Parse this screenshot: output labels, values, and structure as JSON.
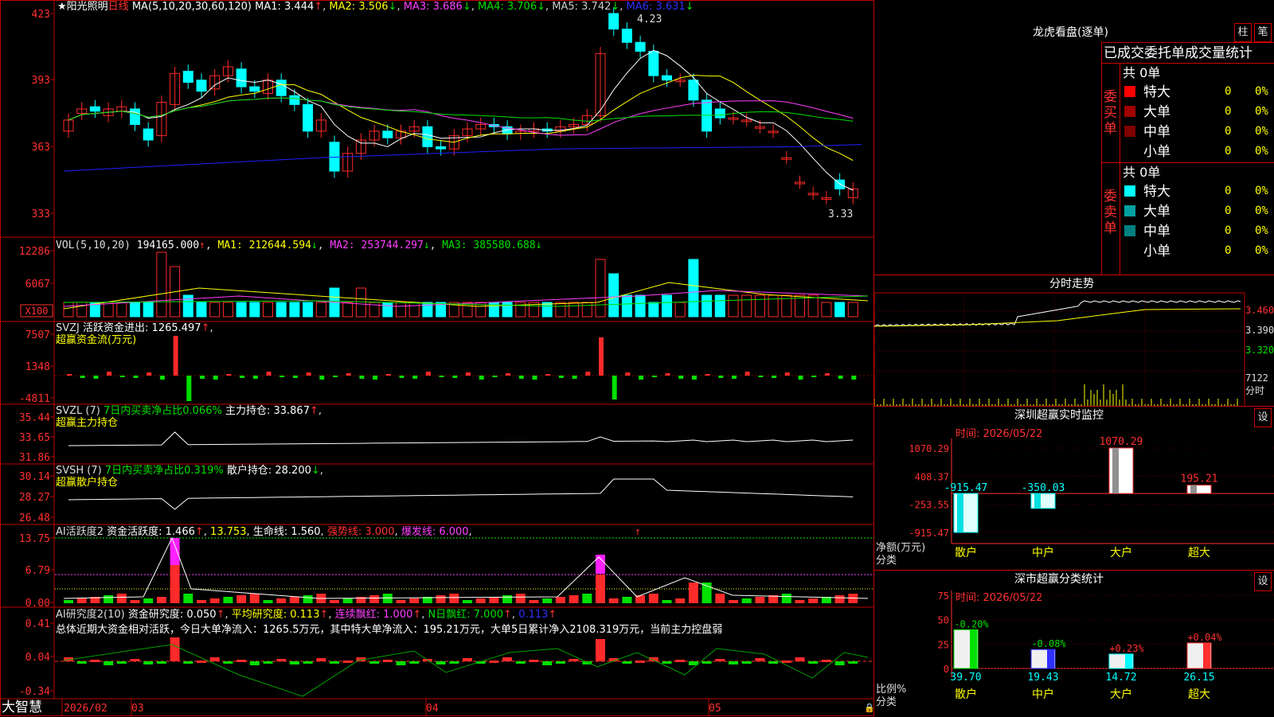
{
  "colors": {
    "up": "#ff2a2a",
    "down": "#00ffff",
    "grid": "#c00000",
    "white": "#ffffff",
    "yellow": "#ffff00",
    "magenta": "#ff40ff",
    "green": "#00e000",
    "blue": "#2020ff",
    "gray": "#a0a0a0"
  },
  "kline": {
    "stock_name": "阳光照明",
    "period": "日线",
    "ma_params": "MA(5,10,20,30,60,120)",
    "ma1": "MA1: 3.444",
    "ma2": "MA2: 3.506",
    "ma3": "MA3: 3.686",
    "ma4": "MA4: 3.706",
    "ma5": "MA5: 3.742",
    "ma6": "MA6: 3.631",
    "yticks": [
      "423",
      "393",
      "363",
      "333"
    ],
    "high_label": "4.23",
    "low_label": "3.33"
  },
  "vol": {
    "title": "VOL(5,10,20)",
    "value": "194165.000",
    "ma1": "MA1: 212644.594",
    "ma2": "MA2: 253744.297",
    "ma3": "MA3: 385580.688",
    "yticks": [
      "12286",
      "6067"
    ],
    "unit": "X100"
  },
  "svzj": {
    "title": "SVZJ",
    "label": "活跃资金进出: 1265.497",
    "sub": "超赢资金流(万元)",
    "yticks": [
      "7507",
      "1348",
      "-4811"
    ]
  },
  "svzl": {
    "title": "SVZL (7)",
    "label": "7日内买卖净占比0.066%",
    "label2": "主力持仓: 33.867",
    "sub": "超赢主力持仓",
    "yticks": [
      "35.44",
      "33.65",
      "31.86"
    ]
  },
  "svsh": {
    "title": "SVSH (7)",
    "label": "7日内买卖净占比0.319%",
    "label2": "散户持仓: 28.200",
    "sub": "超赢散户持仓",
    "yticks": [
      "30.14",
      "28.27",
      "26.48"
    ]
  },
  "ai1": {
    "title": "AI活跃度2",
    "l1": "资金活跃度: 1.466",
    "l2": "13.753",
    "l3": "生命线: 1.560",
    "l4": "强势线: 3.000",
    "l5": "爆发线: 6.000",
    "yticks": [
      "13.75",
      "6.79",
      "0.00"
    ]
  },
  "ai2": {
    "title": "AI研究度2(10)",
    "l1": "资金研究度: 0.050",
    "l2": "平均研究度: 0.113",
    "l3": "连续飘红: 1.000",
    "l4": "N日飘红: 7.000",
    "l5": "0.113",
    "summary": "总体近期大资金相对活跃，今日大单净流入：1265.5万元，其中特大单净流入：195.21万元，大单5日累计净入2108.319万元，当前主力控盘弱",
    "yticks": [
      "0.41",
      "0.04",
      "-0.34"
    ]
  },
  "xaxis": {
    "brand": "大智慧",
    "labels": [
      "2026/02",
      "03",
      "04",
      "05"
    ]
  },
  "longhu": {
    "title": "龙虎看盘(逐单)",
    "tab1": "柱",
    "tab2": "笔",
    "table_title": "已成交委托单成交量统计",
    "buy_side": "委买单",
    "sell_side": "委卖单",
    "buy_total": "共 0单",
    "sell_total": "共 0单",
    "buy_rows": [
      {
        "name": "特大",
        "val": "0",
        "pct": "0%",
        "color": "#ff0000"
      },
      {
        "name": "大单",
        "val": "0",
        "pct": "0%",
        "color": "#a00000"
      },
      {
        "name": "中单",
        "val": "0",
        "pct": "0%",
        "color": "#800000"
      },
      {
        "name": "小单",
        "val": "0",
        "pct": "0%",
        "color": ""
      }
    ],
    "sell_rows": [
      {
        "name": "特大",
        "val": "0",
        "pct": "0%",
        "color": "#00ffff"
      },
      {
        "name": "大单",
        "val": "0",
        "pct": "0%",
        "color": "#00a0a0"
      },
      {
        "name": "中单",
        "val": "0",
        "pct": "0%",
        "color": "#008080"
      },
      {
        "name": "小单",
        "val": "0",
        "pct": "0%",
        "color": ""
      }
    ]
  },
  "fenshi": {
    "title": "分时走势",
    "yticks": [
      "3.460",
      "3.390",
      "3.320"
    ],
    "vol_label": "7122",
    "vol_unit": "分时"
  },
  "sz_monitor": {
    "title": "深圳超赢实时监控",
    "settings": "设",
    "time": "时间: 2026/05/22",
    "yticks": [
      "1070.29",
      "408.37",
      "-253.55",
      "-915.47"
    ],
    "ylabel": "净额(万元)",
    "xlabel": "分类",
    "bars": [
      {
        "name": "散户",
        "value": -915.47,
        "label": "-915.47"
      },
      {
        "name": "中户",
        "value": -350.03,
        "label": "-350.03"
      },
      {
        "name": "大户",
        "value": 1070.29,
        "label": "1070.29"
      },
      {
        "name": "超大",
        "value": 195.21,
        "label": "195.21"
      }
    ]
  },
  "sz_class": {
    "title": "深市超赢分类统计",
    "settings": "设",
    "time": "时间: 2026/05/22",
    "yticks": [
      "75",
      "50",
      "25",
      "0"
    ],
    "ylabel": "比例%",
    "xlabel": "分类",
    "bars": [
      {
        "name": "散户",
        "value": 39.7,
        "label": "39.70",
        "delta": "-0.20%"
      },
      {
        "name": "中户",
        "value": 19.43,
        "label": "19.43",
        "delta": "-0.08%"
      },
      {
        "name": "大户",
        "value": 14.72,
        "label": "14.72",
        "delta": "+0.23%"
      },
      {
        "name": "超大",
        "value": 26.15,
        "label": "26.15",
        "delta": "+0.04%"
      }
    ]
  },
  "chart_data": [
    {
      "type": "bar",
      "title": "深圳超赢实时监控",
      "categories": [
        "散户",
        "中户",
        "大户",
        "超大"
      ],
      "values": [
        -915.47,
        -350.03,
        1070.29,
        195.21
      ],
      "ylim": [
        -915.47,
        1070.29
      ],
      "ylabel": "净额(万元)"
    },
    {
      "type": "bar",
      "title": "深市超赢分类统计",
      "categories": [
        "散户",
        "中户",
        "大户",
        "超大"
      ],
      "values": [
        39.7,
        19.43,
        14.72,
        26.15
      ],
      "ylim": [
        0,
        75
      ],
      "ylabel": "比例%"
    }
  ]
}
